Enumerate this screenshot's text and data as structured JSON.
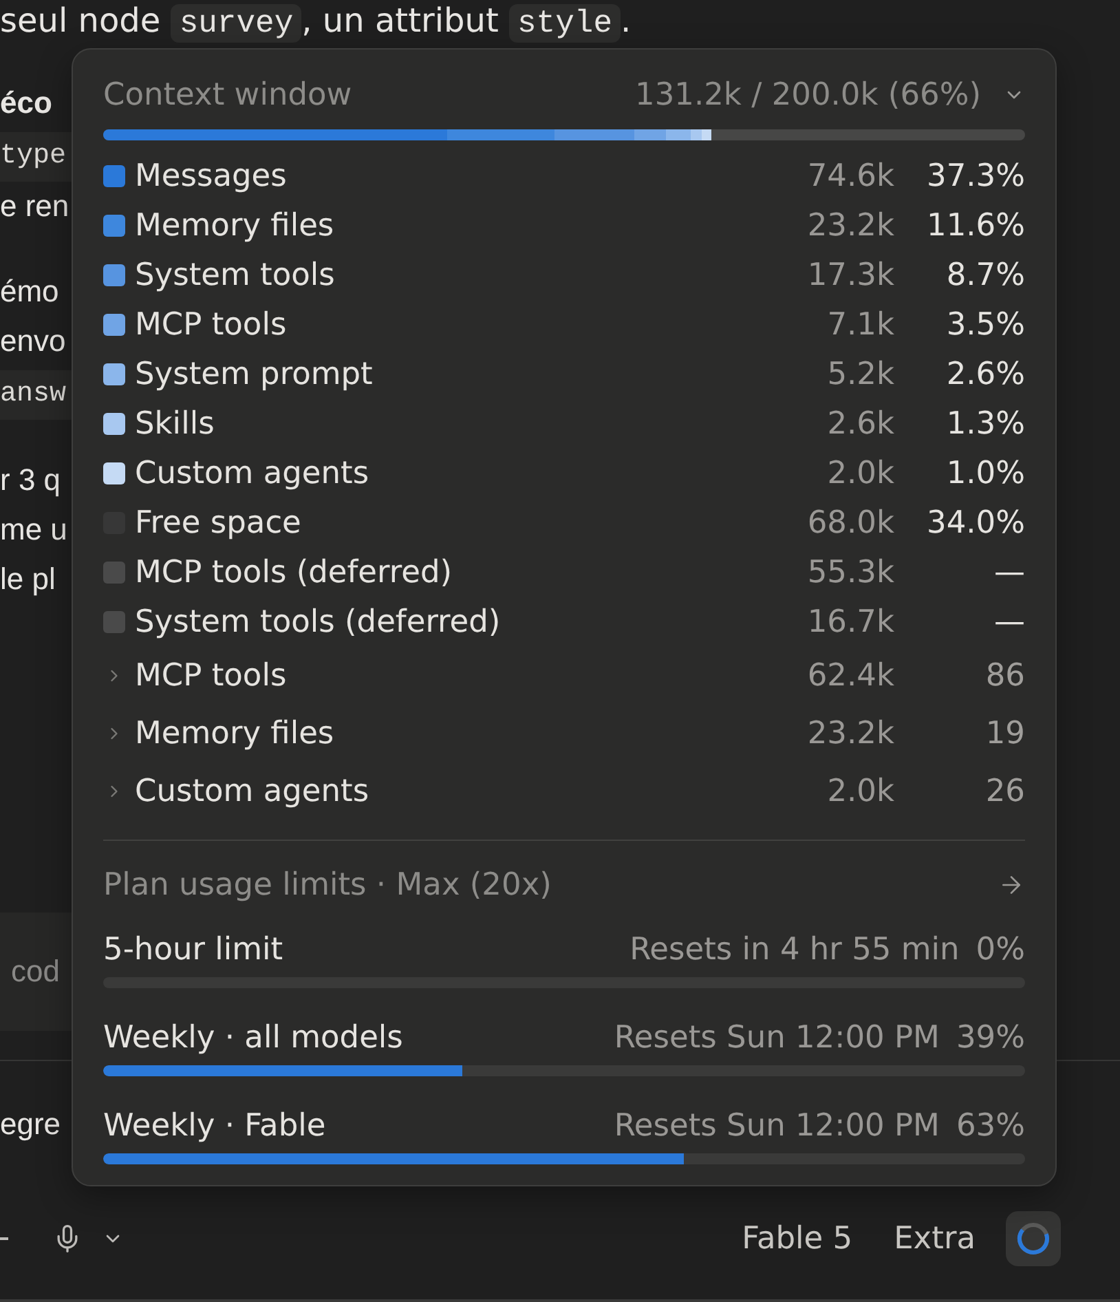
{
  "chat": {
    "intro": [
      {
        "kind": "text",
        "text": "seul node "
      },
      {
        "kind": "code",
        "text": "survey"
      },
      {
        "kind": "text",
        "text": ", un attribut "
      },
      {
        "kind": "code",
        "text": "style"
      },
      {
        "kind": "text",
        "text": "."
      }
    ],
    "blocks": [
      [
        {
          "kind": "heading",
          "text": "éco"
        },
        {
          "kind": "code",
          "text": "type"
        },
        {
          "kind": "text",
          "text": "e ren"
        }
      ],
      [
        {
          "kind": "text",
          "text": "émo"
        },
        {
          "kind": "text",
          "text": "envo"
        },
        {
          "kind": "code",
          "text": "answ"
        }
      ],
      [
        {
          "kind": "text",
          "text": "r 3 q"
        },
        {
          "kind": "text",
          "text": "me u"
        },
        {
          "kind": "text",
          "text": "le pl"
        }
      ]
    ],
    "panel_text": "cod",
    "composer_text": "egre"
  },
  "context": {
    "title": "Context window",
    "summary": "131.2k / 200.0k (66%)",
    "categories": [
      {
        "kind": "used",
        "label": "Messages",
        "tokens": "74.6k",
        "share": "37.3%",
        "color": "#2b79d9"
      },
      {
        "kind": "used",
        "label": "Memory files",
        "tokens": "23.2k",
        "share": "11.6%",
        "color": "#3e87dd"
      },
      {
        "kind": "used",
        "label": "System tools",
        "tokens": "17.3k",
        "share": "8.7%",
        "color": "#5794e0"
      },
      {
        "kind": "used",
        "label": "MCP tools",
        "tokens": "7.1k",
        "share": "3.5%",
        "color": "#70a4e5"
      },
      {
        "kind": "used",
        "label": "System prompt",
        "tokens": "5.2k",
        "share": "2.6%",
        "color": "#8bb6eb"
      },
      {
        "kind": "used",
        "label": "Skills",
        "tokens": "2.6k",
        "share": "1.3%",
        "color": "#a8c8f0"
      },
      {
        "kind": "used",
        "label": "Custom agents",
        "tokens": "2.0k",
        "share": "1.0%",
        "color": "#c5daf4"
      },
      {
        "kind": "free",
        "label": "Free space",
        "tokens": "68.0k",
        "share": "34.0%",
        "color": "#373737"
      },
      {
        "kind": "deferred",
        "label": "MCP tools (deferred)",
        "tokens": "55.3k",
        "share": "—",
        "color": "#4a4a4a"
      },
      {
        "kind": "deferred",
        "label": "System tools (deferred)",
        "tokens": "16.7k",
        "share": "—",
        "color": "#4a4a4a"
      }
    ],
    "groups": [
      {
        "label": "MCP tools",
        "tokens": "62.4k",
        "count": "86",
        "expanded": false
      },
      {
        "label": "Memory files",
        "tokens": "23.2k",
        "count": "19",
        "expanded": false
      },
      {
        "label": "Custom agents",
        "tokens": "2.0k",
        "count": "26",
        "expanded": false
      }
    ]
  },
  "plan": {
    "title": "Plan usage limits · Max (20x)",
    "limits": [
      {
        "label": "5-hour limit",
        "resets": "Resets in 4 hr 55 min",
        "percent": "0%"
      },
      {
        "label": "Weekly · all models",
        "resets": "Resets Sun 12:00 PM",
        "percent": "39%",
        "level": 0.39
      },
      {
        "label": "Weekly · Fable",
        "resets": "Resets Sun 12:00 PM",
        "percent": "63%",
        "level": 0.63
      }
    ]
  },
  "toolbar": {
    "model": "Fable 5",
    "effort": "Extra"
  }
}
